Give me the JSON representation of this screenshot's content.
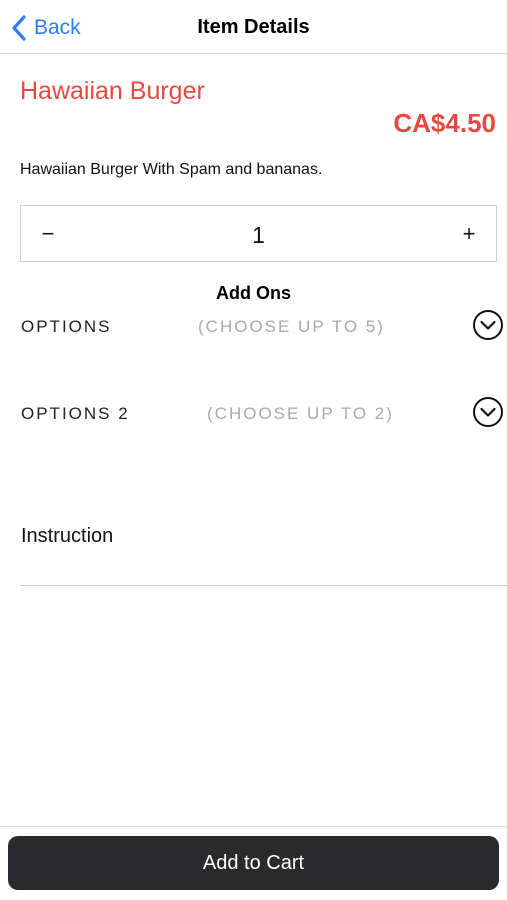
{
  "nav": {
    "back_label": "Back",
    "title": "Item Details"
  },
  "item": {
    "name": "Hawaiian Burger",
    "price": "CA$4.50",
    "description": "Hawaiian Burger With Spam and bananas."
  },
  "quantity": {
    "minus_label": "−",
    "value": "1",
    "plus_label": "+"
  },
  "addons": {
    "title": "Add Ons",
    "options": [
      {
        "label": "OPTIONS",
        "hint": "(CHOOSE UP TO 5)",
        "icon": "chevron-down-circle-icon"
      },
      {
        "label": "OPTIONS 2",
        "hint": "(CHOOSE UP TO 2)",
        "icon": "chevron-down-circle-icon"
      }
    ]
  },
  "instruction": {
    "label": "Instruction",
    "value": ""
  },
  "footer": {
    "add_to_cart_label": "Add to Cart"
  },
  "colors": {
    "accent_blue": "#2f7cf6",
    "price_red": "#e8493f",
    "button_dark": "#2a2a2c",
    "hint_gray": "#a9a9a9"
  }
}
